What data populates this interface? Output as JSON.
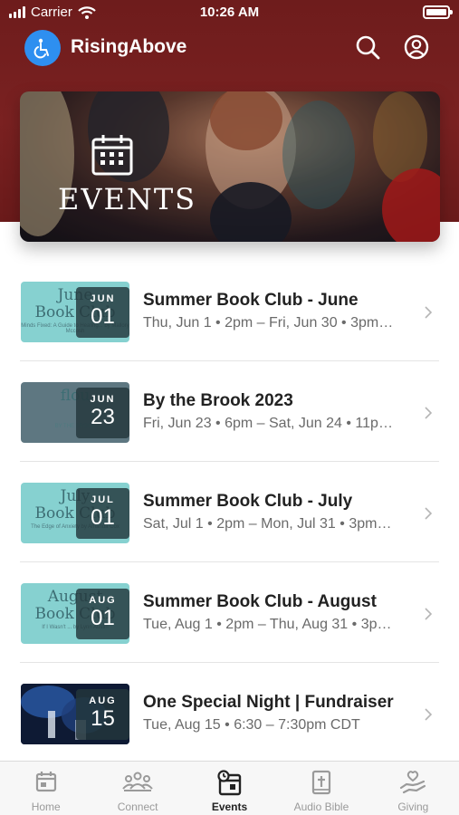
{
  "status_bar": {
    "carrier": "Carrier",
    "time": "10:26 AM"
  },
  "header": {
    "title": "RisingAbove"
  },
  "hero": {
    "label": "EVENTS"
  },
  "events": [
    {
      "title": "Summer Book Club - June",
      "subtitle": "Thu, Jun 1 • 2pm – Fri, Jun 30 • 3pm…",
      "month": "JUN",
      "day": "01",
      "thumb_text": "June\nBook Club",
      "thumb_sub": "Minds Fixed: A Guide to Healing...  by Mallory Mccosh",
      "thumb_color": "#86d1d0"
    },
    {
      "title": "By the Brook 2023",
      "subtitle": "Fri, Jun 23 • 6pm – Sat, Jun 24 • 11p…",
      "month": "JUN",
      "day": "23",
      "thumb_text": "flou",
      "thumb_sub": "BY THE BROOK",
      "thumb_color": "#5e7781"
    },
    {
      "title": "Summer Book Club - July",
      "subtitle": "Sat, Jul 1 • 2pm – Mon, Jul 31 • 3pm…",
      "month": "JUL",
      "day": "01",
      "thumb_text": "July\nBook Club",
      "thumb_sub": "The Edge of Anxiety  by Amanda Cox",
      "thumb_color": "#86d1d0"
    },
    {
      "title": "Summer Book Club - August",
      "subtitle": "Tue, Aug 1 • 2pm – Thu, Aug 31 • 3p…",
      "month": "AUG",
      "day": "01",
      "thumb_text": "August\nBook Club",
      "thumb_sub": "If I Wasn't ...  by Lynn Austin",
      "thumb_color": "#86d1d0"
    },
    {
      "title": "One Special Night | Fundraiser",
      "subtitle": "Tue, Aug 15 • 6:30 – 7:30pm CDT",
      "month": "AUG",
      "day": "15",
      "thumb_text": "",
      "thumb_sub": "",
      "thumb_color": "#1b2a48"
    }
  ],
  "tab_bar": {
    "tabs": [
      {
        "label": "Home",
        "icon": "home-icon"
      },
      {
        "label": "Connect",
        "icon": "connect-icon"
      },
      {
        "label": "Events",
        "icon": "events-icon"
      },
      {
        "label": "Audio Bible",
        "icon": "audio-bible-icon"
      },
      {
        "label": "Giving",
        "icon": "giving-icon"
      }
    ],
    "active_index": 2
  },
  "colors": {
    "header_bg": "#7a2121",
    "brand_blue": "#2e8ff0",
    "thumb_teal": "#86d1d0",
    "badge_bg": "#233739"
  }
}
